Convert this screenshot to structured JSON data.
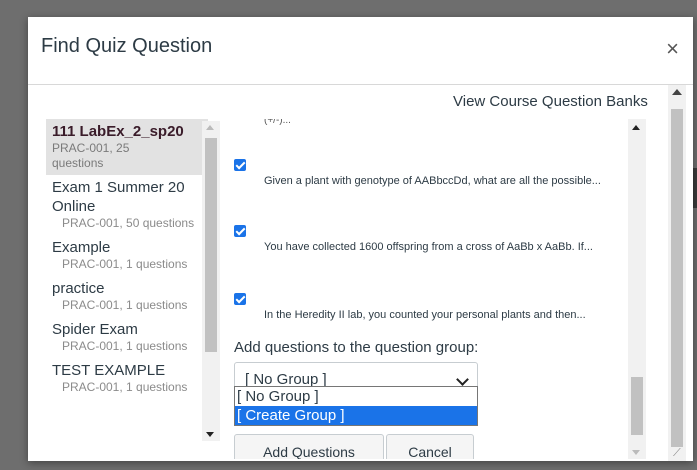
{
  "modal": {
    "title": "Find Quiz Question",
    "close_glyph": "×",
    "view_banks_link": "View Course Question Banks",
    "resize_glyph": "⟋"
  },
  "banks": [
    {
      "name": "111 LabEx_2_sp20",
      "meta": "PRAC-001, 25 questions",
      "selected": true
    },
    {
      "name": "Exam 1 Summer 20 Online",
      "meta": "PRAC-001, 50 questions",
      "selected": false
    },
    {
      "name": "Example",
      "meta": "PRAC-001, 1 questions",
      "selected": false
    },
    {
      "name": "practice",
      "meta": "PRAC-001, 1 questions",
      "selected": false
    },
    {
      "name": "Spider Exam",
      "meta": "PRAC-001, 1 questions",
      "selected": false
    },
    {
      "name": "TEST EXAMPLE",
      "meta": "PRAC-001, 1 questions",
      "selected": false
    }
  ],
  "questions": {
    "cut_top_text": "(+/-)...",
    "items": [
      {
        "text": "Given a plant with genotype of AABbccDd, what are all the possible...",
        "checked": true
      },
      {
        "text": "You have collected 1600 offspring from a cross of AaBb x AaBb. If...",
        "checked": true
      },
      {
        "text": "In the Heredity II lab, you counted your personal plants and then...",
        "checked": true
      }
    ]
  },
  "group": {
    "label": "Add questions to the question group:",
    "selected": "[ No Group ]",
    "options": [
      "[ No Group ]",
      "[ Create Group ]"
    ],
    "highlighted_option": "[ Create Group ]"
  },
  "buttons": {
    "add": "Add Questions",
    "cancel": "Cancel"
  },
  "colors": {
    "accent": "#1a73e8",
    "overlay": "#6e6e6e",
    "selected_bank_bg": "#e2e2e2"
  }
}
